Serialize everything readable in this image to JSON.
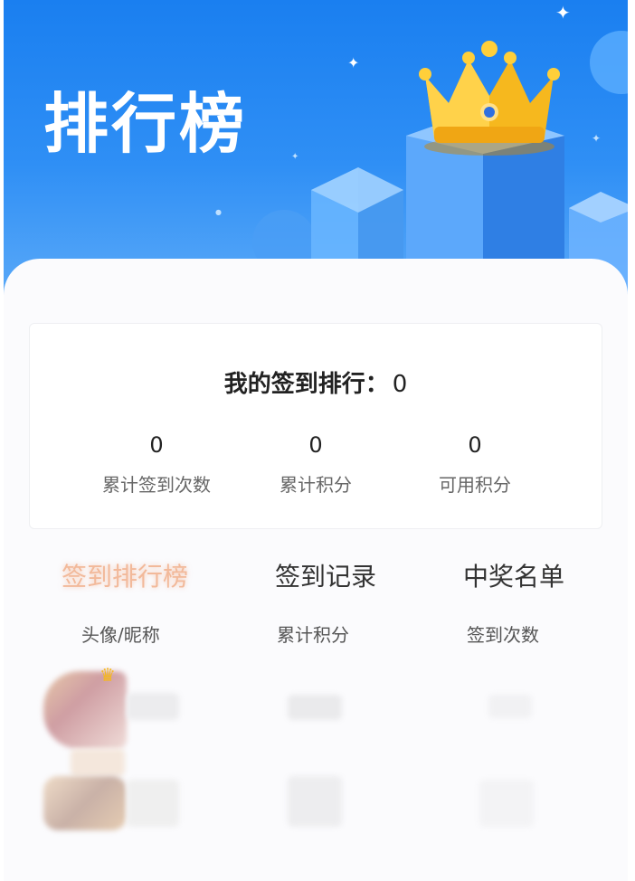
{
  "header": {
    "title": "排行榜"
  },
  "my_rank": {
    "label": "我的签到排行：",
    "value": "0"
  },
  "stats": [
    {
      "value": "0",
      "label": "累计签到次数"
    },
    {
      "value": "0",
      "label": "累计积分"
    },
    {
      "value": "0",
      "label": "可用积分"
    }
  ],
  "tabs": [
    {
      "label": "签到排行榜",
      "active": true
    },
    {
      "label": "签到记录",
      "active": false
    },
    {
      "label": "中奖名单",
      "active": false
    }
  ],
  "columns": [
    "头像/昵称",
    "累计积分",
    "签到次数"
  ],
  "colors": {
    "hero_blue": "#1a7ff0",
    "active_tab": "#f2b99a",
    "crown_gold": "#f6b81e"
  },
  "icons": {
    "hero": "crown-icon",
    "top_rank": "crown-icon",
    "sparkle": "sparkle-icon"
  }
}
